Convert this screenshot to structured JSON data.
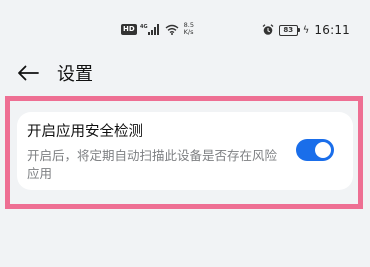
{
  "status_bar": {
    "hd": "HD",
    "net_speed_value": "8.5",
    "net_speed_unit": "K/s",
    "battery": "83",
    "time": "16:11"
  },
  "header": {
    "back_icon": "arrow-left-icon",
    "title": "设置"
  },
  "setting": {
    "title": "开启应用安全检测",
    "description": "开启后，将定期自动扫描此设备是否存在风险应用",
    "enabled": true
  },
  "colors": {
    "accent": "#1a6eea",
    "highlight": "#ee6f93",
    "background": "#f1f3f5"
  }
}
